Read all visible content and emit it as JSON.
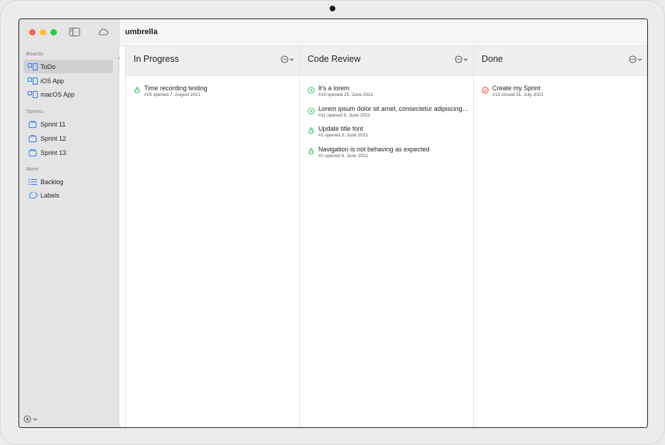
{
  "colors": {
    "close": "#fe5f57",
    "minimize": "#febc2e",
    "zoom": "#28c840",
    "accent": "#3478f6",
    "open_issue": "#34c759",
    "closed_issue": "#ff3b30"
  },
  "app": {
    "title": "umbrella"
  },
  "sidebar": {
    "sections": [
      {
        "title": "Boards",
        "items": [
          {
            "label": "ToDo",
            "icon": "board-icon",
            "active": true
          },
          {
            "label": "iOS App",
            "icon": "board-icon"
          },
          {
            "label": "macOS App",
            "icon": "board-icon"
          }
        ]
      },
      {
        "title": "Sprints",
        "items": [
          {
            "label": "Sprint 11",
            "icon": "sprint-icon"
          },
          {
            "label": "Sprint 12",
            "icon": "sprint-icon"
          },
          {
            "label": "Sprint 13",
            "icon": "sprint-icon"
          }
        ]
      },
      {
        "title": "More",
        "items": [
          {
            "label": "Backlog",
            "icon": "list-icon"
          },
          {
            "label": "Labels",
            "icon": "tag-icon"
          }
        ]
      }
    ]
  },
  "columns": [
    {
      "title": "In Progress",
      "issues": [
        {
          "title": "Time recording testing",
          "meta": "#25 opened 7. August 2021",
          "icon": "bug-icon"
        }
      ]
    },
    {
      "title": "Code Review",
      "issues": [
        {
          "title": "It's a lorem",
          "meta": "#16 opened 25. June 2021",
          "icon": "issue-open-icon"
        },
        {
          "title": "Lorem ipsum dolor sit amet, consectetur adipiscing elit",
          "meta": "#11 opened 5. June 2021",
          "icon": "issue-open-icon"
        },
        {
          "title": "Update title font",
          "meta": "#1 opened 3. June 2021",
          "icon": "bug-icon"
        },
        {
          "title": "Navigation is not behaving as expected",
          "meta": "#2 opened 4. June 2021",
          "icon": "bug-icon"
        }
      ]
    },
    {
      "title": "Done",
      "issues": [
        {
          "title": "Create my Sprint",
          "meta": "#13 closed 31. July 2021",
          "icon": "issue-closed-icon"
        }
      ]
    }
  ]
}
